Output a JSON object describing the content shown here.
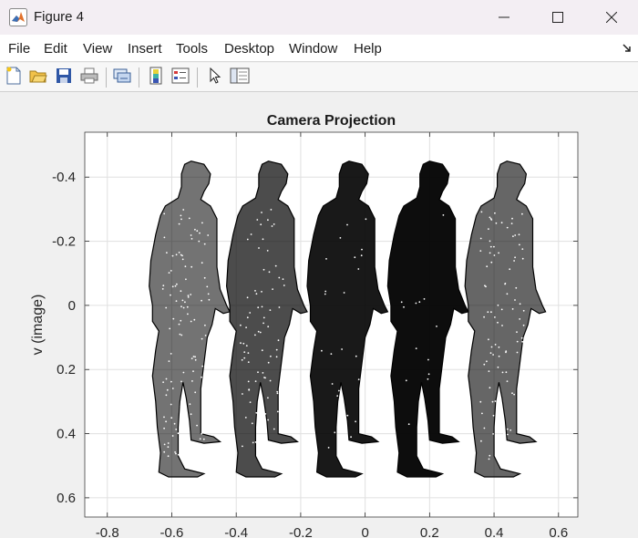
{
  "window": {
    "title": "Figure 4",
    "app_icon": "matlab-icon",
    "controls": [
      "minimize-icon",
      "maximize-icon",
      "close-icon"
    ]
  },
  "menu": {
    "items": [
      "File",
      "Edit",
      "View",
      "Insert",
      "Tools",
      "Desktop",
      "Window",
      "Help"
    ]
  },
  "toolbar": {
    "buttons": [
      "new-figure-icon",
      "open-file-icon",
      "save-icon",
      "print-icon",
      "link-plot-icon",
      "insert-colorbar-icon",
      "insert-legend-icon",
      "edit-plot-arrow-icon",
      "property-inspector-icon"
    ]
  },
  "chart_data": {
    "type": "scatter",
    "title": "Camera Projection",
    "xlabel": "",
    "ylabel": "v (image)",
    "xlim": [
      -0.87,
      0.66
    ],
    "ylim": [
      -0.54,
      0.66
    ],
    "y_reversed": true,
    "grid": true,
    "xticks": [
      "-0.8",
      "-0.6",
      "-0.4",
      "-0.2",
      "0",
      "0.2",
      "0.4",
      "0.6"
    ],
    "yticks": [
      "-0.4",
      "-0.2",
      "0",
      "0.2",
      "0.4",
      "0.6"
    ],
    "marker_color": "#000000",
    "series": [
      {
        "center_x": -0.56,
        "density": 0.55
      },
      {
        "center_x": -0.32,
        "density": 0.7
      },
      {
        "center_x": -0.07,
        "density": 0.9
      },
      {
        "center_x": 0.18,
        "density": 0.95
      },
      {
        "center_x": 0.42,
        "density": 0.6
      }
    ]
  }
}
